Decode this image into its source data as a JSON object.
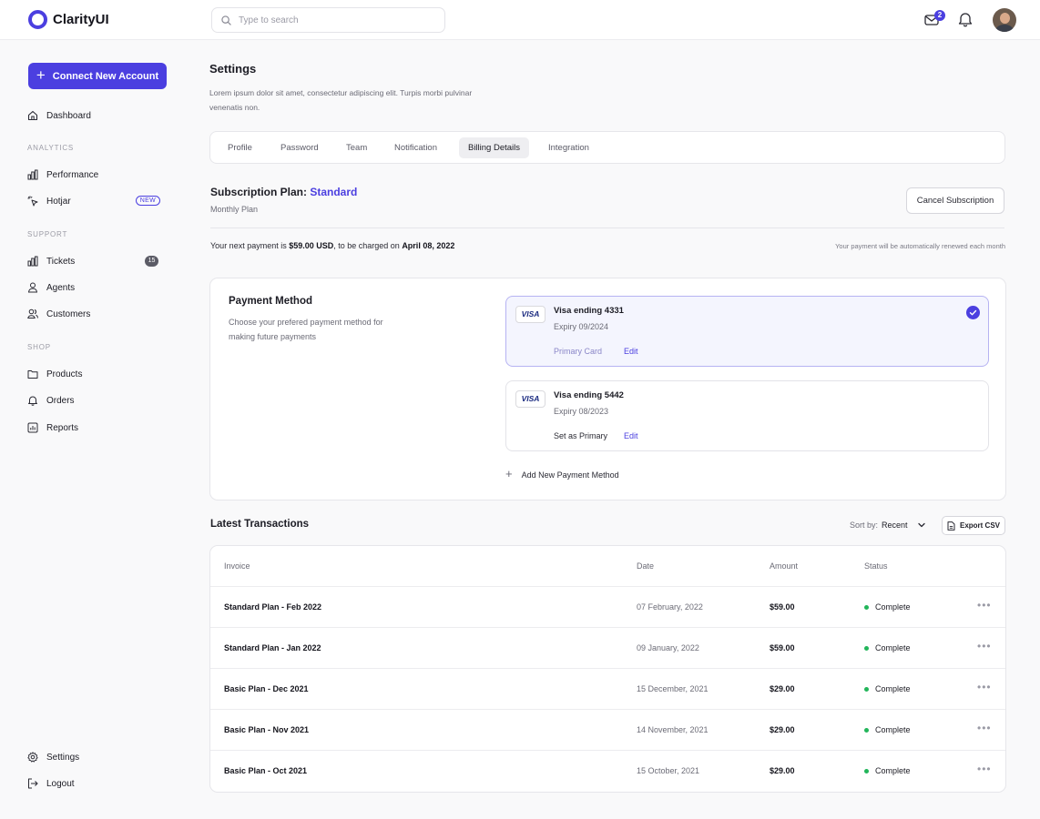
{
  "app": {
    "name": "ClarityUI"
  },
  "search": {
    "placeholder": "Type to search"
  },
  "header": {
    "mail_count": "2"
  },
  "sidebar": {
    "connect_label": "Connect New Account",
    "dashboard": "Dashboard",
    "analytics_section": "ANALYTICS",
    "performance": "Performance",
    "hotjar": "Hotjar",
    "hotjar_badge": "NEW",
    "support_section": "SUPPORT",
    "tickets": "Tickets",
    "tickets_count": "15",
    "agents": "Agents",
    "customers": "Customers",
    "shop_section": "SHOP",
    "products": "Products",
    "orders": "Orders",
    "reports": "Reports",
    "settings": "Settings",
    "logout": "Logout"
  },
  "page": {
    "title": "Settings",
    "description": "Lorem ipsum dolor sit amet, consectetur adipiscing elit. Turpis morbi pulvinar venenatis non."
  },
  "tabs": [
    "Profile",
    "Password",
    "Team",
    "Notification",
    "Billing Details",
    "Integration"
  ],
  "active_tab": "Billing Details",
  "subscription": {
    "label": "Subscription Plan: ",
    "plan": "Standard",
    "period": "Monthly Plan",
    "cancel_label": "Cancel Subscription",
    "next_prefix": "Your next payment is ",
    "next_amount": "$59.00 USD",
    "next_mid": ", to be charged on ",
    "next_date": "April 08, 2022",
    "renew_note": "Your payment will be automatically renewed each month"
  },
  "payment_method": {
    "title": "Payment Method",
    "description": "Choose your prefered payment method for making future payments",
    "cards": [
      {
        "brand": "VISA",
        "name": "Visa ending 4331",
        "expiry": "Expiry 09/2024",
        "action": "Primary Card",
        "edit": "Edit"
      },
      {
        "brand": "VISA",
        "name": "Visa ending 5442",
        "expiry": "Expiry 08/2023",
        "action": "Set as Primary",
        "edit": "Edit"
      }
    ],
    "add_label": "Add New Payment Method"
  },
  "transactions": {
    "title": "Latest Transactions",
    "sort_prefix": "Sort by: ",
    "sort_value": "Recent",
    "export_label": "Export CSV",
    "columns": {
      "invoice": "Invoice",
      "date": "Date",
      "amount": "Amount",
      "status": "Status"
    },
    "rows": [
      {
        "invoice": "Standard Plan - Feb 2022",
        "date": "07 February, 2022",
        "amount": "$59.00",
        "status": "Complete"
      },
      {
        "invoice": "Standard Plan - Jan 2022",
        "date": "09 January, 2022",
        "amount": "$59.00",
        "status": "Complete"
      },
      {
        "invoice": "Basic Plan - Dec 2021",
        "date": "15 December, 2021",
        "amount": "$29.00",
        "status": "Complete"
      },
      {
        "invoice": "Basic Plan - Nov 2021",
        "date": "14 November, 2021",
        "amount": "$29.00",
        "status": "Complete"
      },
      {
        "invoice": "Basic Plan - Oct 2021",
        "date": "15 October, 2021",
        "amount": "$29.00",
        "status": "Complete"
      }
    ]
  },
  "colors": {
    "accent": "#4b3fe0",
    "status_complete": "#22b55a"
  }
}
